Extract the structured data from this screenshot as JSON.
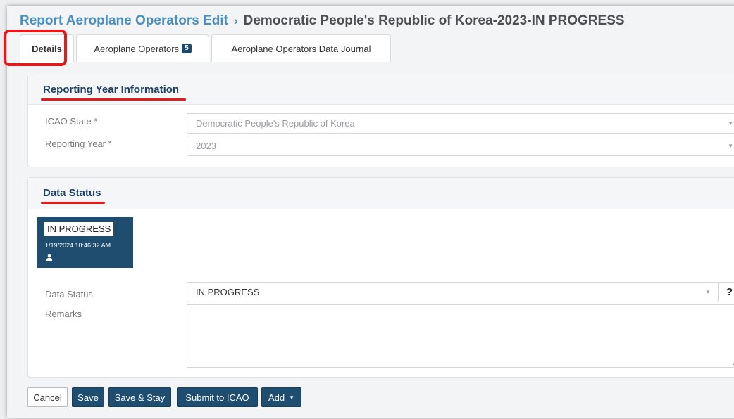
{
  "breadcrumb": {
    "parent": "Report Aeroplane Operators Edit",
    "separator": "›",
    "current": "Democratic People's Republic of Korea-2023-IN PROGRESS"
  },
  "tabs": [
    {
      "label": "Details",
      "active": true
    },
    {
      "label": "Aeroplane Operators",
      "badge": "5",
      "active": false
    },
    {
      "label": "Aeroplane Operators Data Journal",
      "active": false
    }
  ],
  "reporting_year": {
    "title": "Reporting Year Information",
    "icao_state_label": "ICAO State *",
    "icao_state_value": "Democratic People's Republic of Korea",
    "year_label": "Reporting Year *",
    "year_value": "2023"
  },
  "data_status": {
    "title": "Data Status",
    "card_status": "IN PROGRESS",
    "card_timestamp": "1/19/2024 10:46:32 AM",
    "status_label": "Data Status",
    "status_value": "IN PROGRESS",
    "help": "?",
    "remarks_label": "Remarks",
    "remarks_value": ""
  },
  "actions": {
    "cancel": "Cancel",
    "save": "Save",
    "save_stay": "Save & Stay",
    "submit": "Submit to ICAO",
    "add": "Add"
  },
  "icons": {
    "caret": "caret-down-icon",
    "user": "user-icon",
    "resize": "resize-grip-icon"
  },
  "colors": {
    "primary": "#1e4d70",
    "link": "#4a8fc1",
    "title": "#1e3f66",
    "annotation": "#e31b1b"
  }
}
